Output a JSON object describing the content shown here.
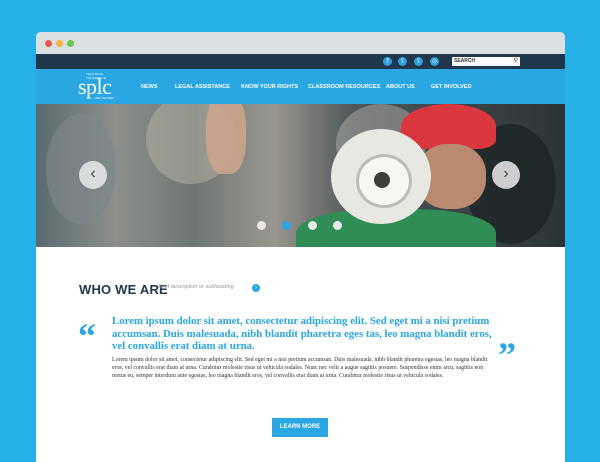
{
  "social": [
    {
      "icon": "facebook-icon",
      "glyph": "f"
    },
    {
      "icon": "twitter-icon",
      "glyph": "t"
    },
    {
      "icon": "tumblr-icon",
      "glyph": "t"
    },
    {
      "icon": "rss-icon",
      "glyph": "⊙"
    }
  ],
  "search": {
    "placeholder": "SEARCH",
    "icon": "search-icon",
    "glyph": "⚲"
  },
  "logo": {
    "top_text": "TEACHING TOLERANCE",
    "main": "splc",
    "bottom_text": "LAW CENTER"
  },
  "nav": {
    "items": [
      "NEWS",
      "LEGAL ASSISTANCE",
      "KNOW YOUR RIGHTS",
      "CLASSROOM RESOURCES",
      "ABOUT US",
      "GET INVOLVED"
    ]
  },
  "hero": {
    "prev_glyph": "‹",
    "next_glyph": "›",
    "slides_count": 4,
    "active_slide": 2
  },
  "section": {
    "title": "WHO WE ARE",
    "subtitle": "Brief description or subheading",
    "subtitle_arrow": "›"
  },
  "quote": {
    "open_glyph": "“",
    "close_glyph": "”",
    "lead": "Lorem ipsum dolor sit amet, consectetur adipiscing elit. Sed eget mi a nisi pretium accumsan. Duis malesuada, nibh blandit pharetra eges tas, leo magna blandit eros, vel convallis erat diam at urna.",
    "body": "Lorem ipsum dolor sit amet, consectetur adipiscing elit. Sed eget mi a nisi pretium accumsan. Duis malesuada, nibh blandit pharetra egestas, leo magna blandit eros, vel convallis erat diam at urna. Curabitur molestie risus ut vehicula sodales. Nunc nec velit a augue sagittis posuere. Suspendisse enim arcu, sagittis non metus eu, semper interdum ante egestas, leo magna blandit eros, vel convallis erat diam at urna. Curabitur molestie risus ut vehicula sodales."
  },
  "cta": {
    "label": "LEARN MORE"
  },
  "colors": {
    "page_bg": "#25b0e8",
    "nav_bg": "#2aa6e2",
    "utility_bg": "#20364a",
    "accent": "#2aa6e2",
    "heading": "#22384c"
  }
}
